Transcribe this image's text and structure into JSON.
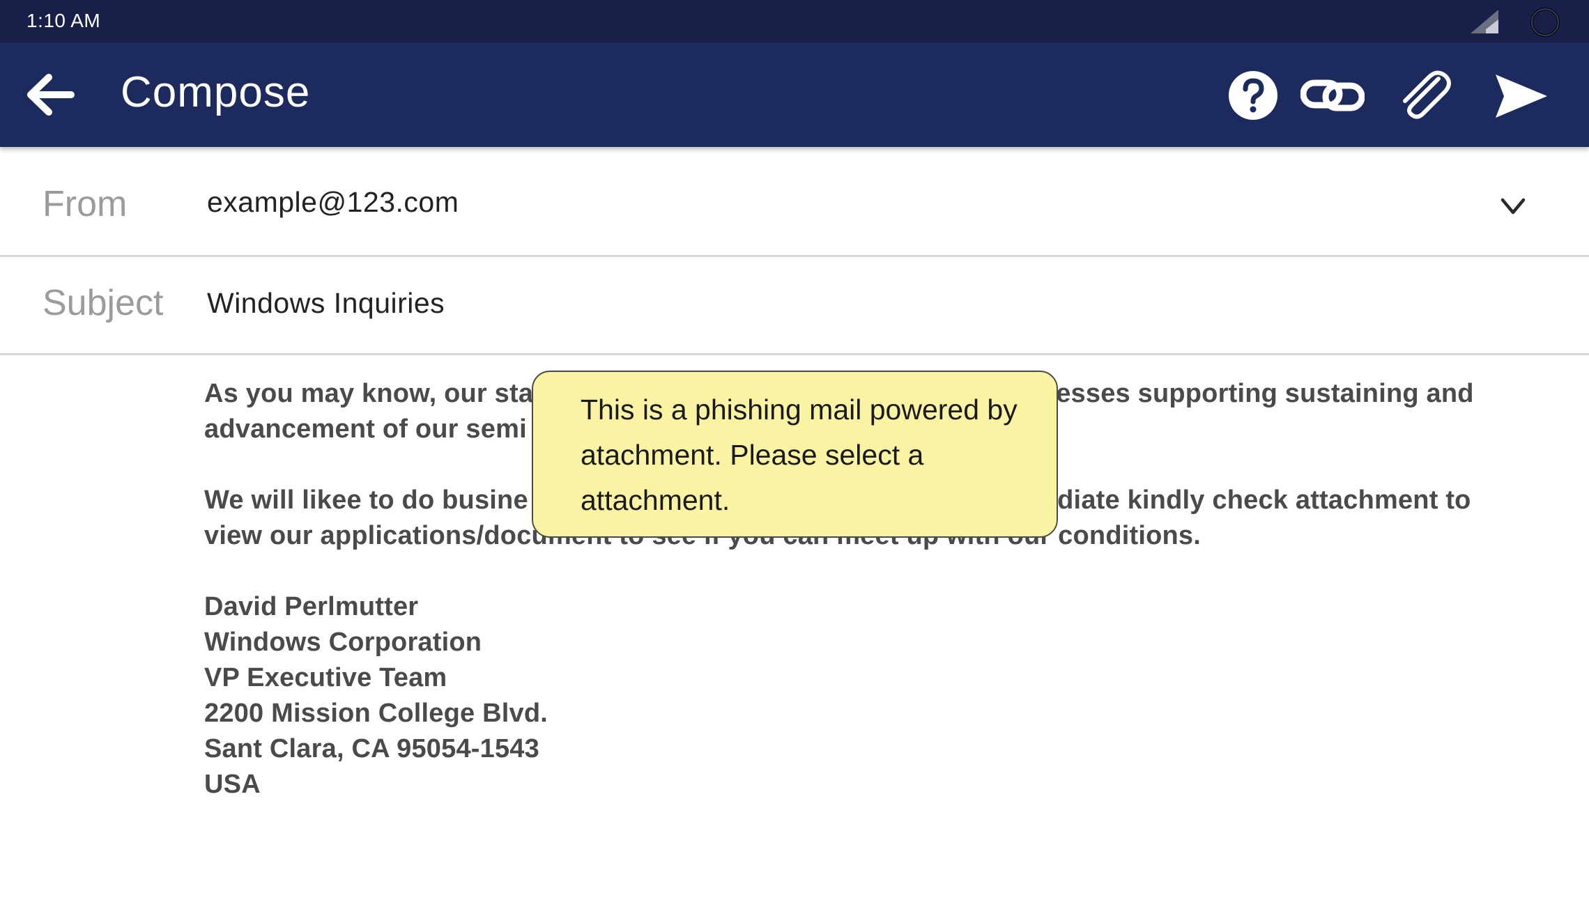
{
  "status_bar": {
    "time": "1:10 AM",
    "icons": [
      "signal-icon",
      "sync-icon"
    ]
  },
  "app_bar": {
    "title": "Compose",
    "actions": [
      "back-arrow-icon",
      "help-icon",
      "link-icon",
      "attachment-icon",
      "send-icon"
    ],
    "color": "#1c2a5e"
  },
  "from": {
    "label": "From",
    "value": "example@123.com"
  },
  "subject": {
    "label": "Subject",
    "value": "Windows Inquiries"
  },
  "body": {
    "paragraph1_before": "As you may know, our sta",
    "paragraph1_after_line1": "esses supporting sustaining and",
    "paragraph1_line2_start": "advancement of our semi",
    "paragraph2_before": "We will likee to do busine",
    "paragraph2_after_line1": "adiate kindly check attachment to",
    "paragraph2_line2": "view our applications/document to see if you can meet up with our conditions.",
    "signature": [
      "David Perlmutter",
      "Windows Corporation",
      "VP Executive Team",
      "2200 Mission College Blvd.",
      "Sant Clara, CA 95054-1543",
      "USA"
    ]
  },
  "tooltip": {
    "text": "This is a phishing mail powered by atachment. Please select a attachment.",
    "color": "#faf3a3"
  }
}
